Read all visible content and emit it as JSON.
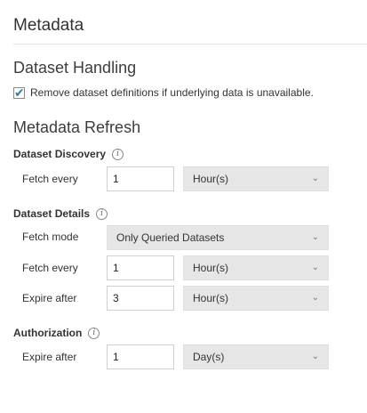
{
  "page_title": "Metadata",
  "dataset_handling": {
    "heading": "Dataset Handling",
    "remove_checkbox": {
      "checked": true,
      "label": "Remove dataset definitions if underlying data is unavailable."
    }
  },
  "metadata_refresh": {
    "heading": "Metadata Refresh",
    "dataset_discovery": {
      "title": "Dataset Discovery",
      "fetch_every": {
        "label": "Fetch every",
        "value": "1",
        "unit": "Hour(s)"
      }
    },
    "dataset_details": {
      "title": "Dataset Details",
      "fetch_mode": {
        "label": "Fetch mode",
        "value": "Only Queried Datasets"
      },
      "fetch_every": {
        "label": "Fetch every",
        "value": "1",
        "unit": "Hour(s)"
      },
      "expire_after": {
        "label": "Expire after",
        "value": "3",
        "unit": "Hour(s)"
      }
    },
    "authorization": {
      "title": "Authorization",
      "expire_after": {
        "label": "Expire after",
        "value": "1",
        "unit": "Day(s)"
      }
    }
  },
  "icons": {
    "info": "info-icon",
    "chevron": "chevron-down-icon",
    "check": "checkmark-icon"
  },
  "colors": {
    "accent": "#2f7fa3",
    "select_bg": "#e6e6e6"
  }
}
